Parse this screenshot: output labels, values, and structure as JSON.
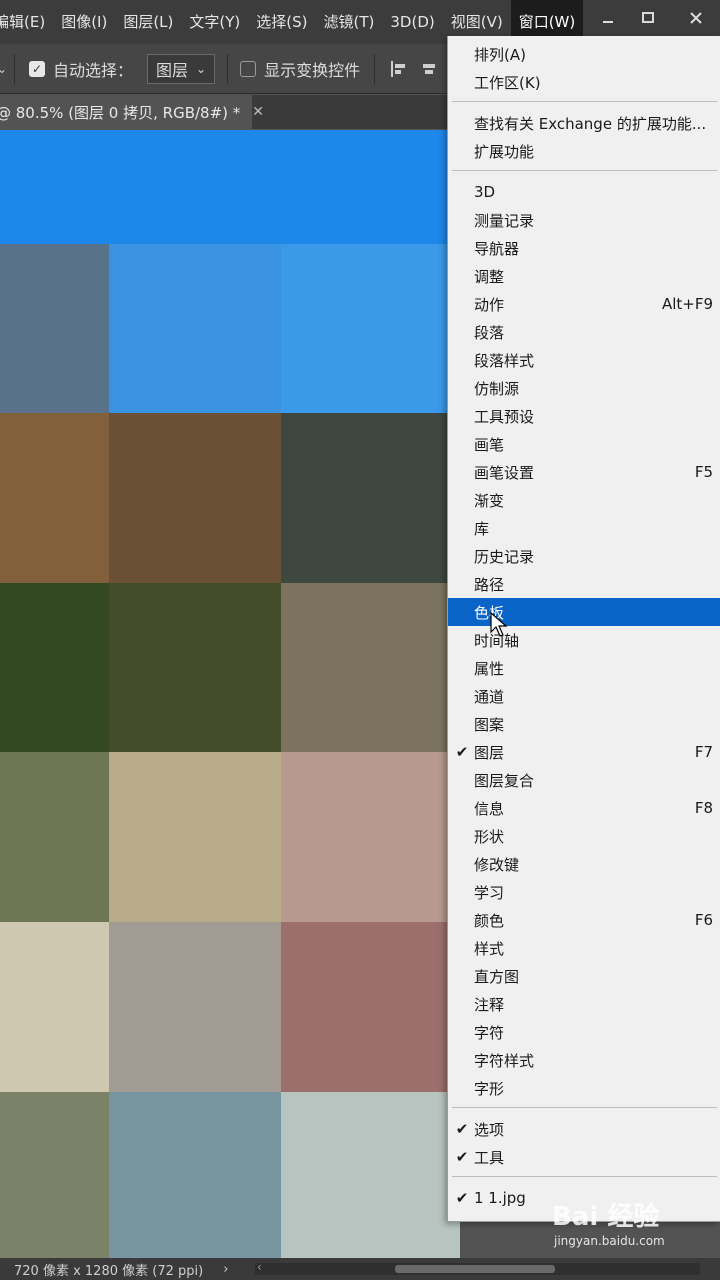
{
  "menubar": {
    "items": [
      "编辑(E)",
      "图像(I)",
      "图层(L)",
      "文字(Y)",
      "选择(S)",
      "滤镜(T)",
      "3D(D)",
      "视图(V)",
      "窗口(W)"
    ],
    "active_index": 8
  },
  "options": {
    "auto_select_label": "自动选择：",
    "auto_select_checked": true,
    "target_value": "图层",
    "show_transform_label": "显示变换控件",
    "show_transform_checked": false
  },
  "document_tab": {
    "title": "@ 80.5% (图层 0 拷贝, RGB/8#) *"
  },
  "canvas_colors": [
    [
      "#1e87ea",
      "#1e87ea",
      "#1e87ea"
    ],
    [
      "#58728a",
      "#3a93e0",
      "#3a99e8"
    ],
    [
      "#82603c",
      "#6a5035",
      "#3e4840"
    ],
    [
      "#334a21",
      "#434d2b",
      "#7b735d"
    ],
    [
      "#6e7552",
      "#b8ac88",
      "#b7998f"
    ],
    [
      "#cfc8b1",
      "#a19b94",
      "#9a6f6c"
    ],
    [
      "#7b8268",
      "#7896a0",
      "#b8c4c0"
    ]
  ],
  "window_menu": {
    "groups": [
      [
        {
          "label": "排列(A)"
        },
        {
          "label": "工作区(K)"
        }
      ],
      [
        {
          "label": "查找有关 Exchange 的扩展功能..."
        },
        {
          "label": "扩展功能"
        }
      ],
      [
        {
          "label": "3D"
        },
        {
          "label": "测量记录"
        },
        {
          "label": "导航器"
        },
        {
          "label": "调整"
        },
        {
          "label": "动作",
          "shortcut": "Alt+F9"
        },
        {
          "label": "段落"
        },
        {
          "label": "段落样式"
        },
        {
          "label": "仿制源"
        },
        {
          "label": "工具预设"
        },
        {
          "label": "画笔"
        },
        {
          "label": "画笔设置",
          "shortcut": "F5"
        },
        {
          "label": "渐变"
        },
        {
          "label": "库"
        },
        {
          "label": "历史记录"
        },
        {
          "label": "路径"
        },
        {
          "label": "色板",
          "highlighted": true
        },
        {
          "label": "时间轴"
        },
        {
          "label": "属性"
        },
        {
          "label": "通道"
        },
        {
          "label": "图案"
        },
        {
          "label": "图层",
          "checked": true,
          "shortcut": "F7"
        },
        {
          "label": "图层复合"
        },
        {
          "label": "信息",
          "shortcut": "F8"
        },
        {
          "label": "形状"
        },
        {
          "label": "修改键"
        },
        {
          "label": "学习"
        },
        {
          "label": "颜色",
          "shortcut": "F6"
        },
        {
          "label": "样式"
        },
        {
          "label": "直方图"
        },
        {
          "label": "注释"
        },
        {
          "label": "字符"
        },
        {
          "label": "字符样式"
        },
        {
          "label": "字形"
        }
      ],
      [
        {
          "label": "选项",
          "checked": true
        },
        {
          "label": "工具",
          "checked": true
        }
      ],
      [
        {
          "label": "1 1.jpg",
          "checked": true
        }
      ]
    ]
  },
  "status": {
    "dimensions": "720 像素 x 1280 像素 (72 ppi)"
  },
  "watermark": {
    "line1": "Bai 经验",
    "line2": "jingyan.baidu.com"
  }
}
